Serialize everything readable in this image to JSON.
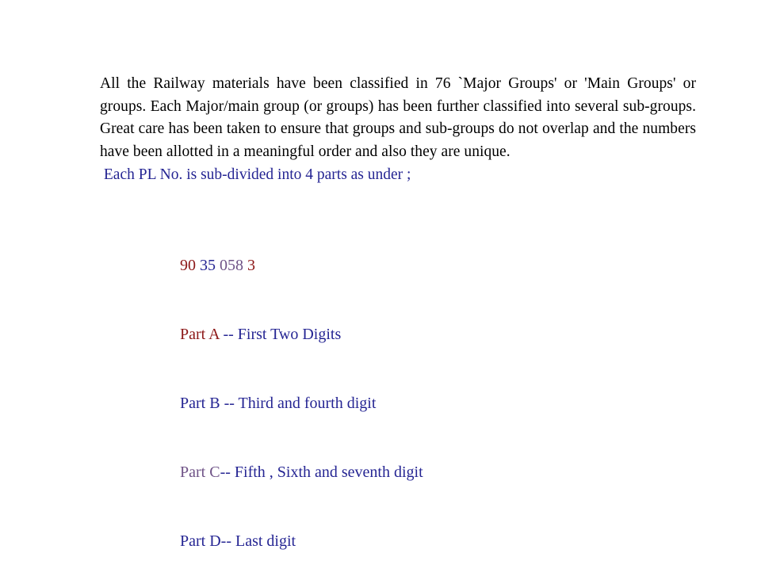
{
  "slide": {
    "background_color": "#ffffff",
    "paragraph": {
      "text": "All the Railway materials have been classified in 76 `Major Groups' or 'Main Groups' or groups. Each Major/main group (or groups) has been further classified into several sub-groups. Great care has been taken to ensure that groups and sub-groups do not overlap and the numbers have been allotted in a meaningful order and also they are unique.",
      "color": "#000000",
      "lines": [
        "All the Railway materials have been classified in 76 `Major Groups' or 'Main",
        "Groups' or groups. Each Major/main group (or groups) has been further",
        "classified into several sub-groups. Great care has been taken to ensure that",
        "groups and sub-groups do not overlap and the numbers have been allotted in a",
        "meaningful order and also they are unique."
      ]
    },
    "subdivision_line": {
      "text": " Each PL No. is sub-divided into 4 parts as under ;",
      "color": "#252593"
    },
    "example": {
      "name": "pl-number-example",
      "segments": [
        {
          "text": "90",
          "color": "#8C1717"
        },
        {
          "text": " ",
          "color": "#000000"
        },
        {
          "text": "35",
          "color": "#252593"
        },
        {
          "text": " ",
          "color": "#000000"
        },
        {
          "text": "058",
          "color": "#6F5387"
        },
        {
          "text": " ",
          "color": "#000000"
        },
        {
          "text": "3",
          "color": "#8C1717"
        }
      ]
    },
    "parts": [
      {
        "label": "Part A",
        "label_color": "#8C1717",
        "description": " -- First Two Digits",
        "description_color": "#252593"
      },
      {
        "label": "Part B",
        "label_color": "#252593",
        "description": " -- Third and fourth digit",
        "description_color": "#252593"
      },
      {
        "label": "Part C",
        "label_color": "#6F5387",
        "description": "-- Fifth , Sixth and seventh digit",
        "description_color": "#252593"
      },
      {
        "label": "Part D",
        "label_color": "#252593",
        "description": "-- Last digit",
        "description_color": "#252593"
      }
    ]
  }
}
